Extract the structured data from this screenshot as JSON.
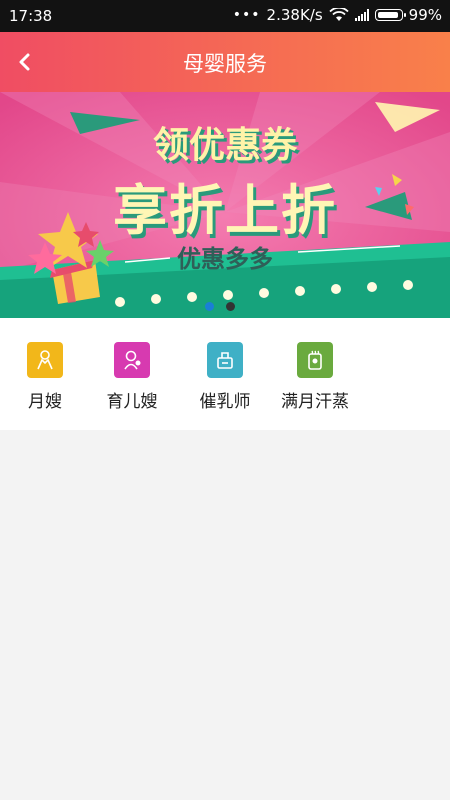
{
  "status_bar": {
    "time": "17:38",
    "speed": "2.38K/s",
    "battery": "99%",
    "battery_level": 0.99
  },
  "header": {
    "title": "母婴服务"
  },
  "banner": {
    "line1": "领优惠券",
    "line2": "享折上折",
    "line3": "优惠多多",
    "slide_count": 2,
    "active_slide": 1
  },
  "services": [
    {
      "label": "月嫂",
      "icon": "yuesao-icon",
      "color": "#f2b71a"
    },
    {
      "label": "育儿嫂",
      "icon": "yuersao-icon",
      "color": "#d73ab0"
    },
    {
      "label": "催乳师",
      "icon": "cuirushi-icon",
      "color": "#3fb0c6"
    },
    {
      "label": "满月汗蒸",
      "icon": "manyue-hanzheng-icon",
      "color": "#6aaa3e"
    }
  ]
}
